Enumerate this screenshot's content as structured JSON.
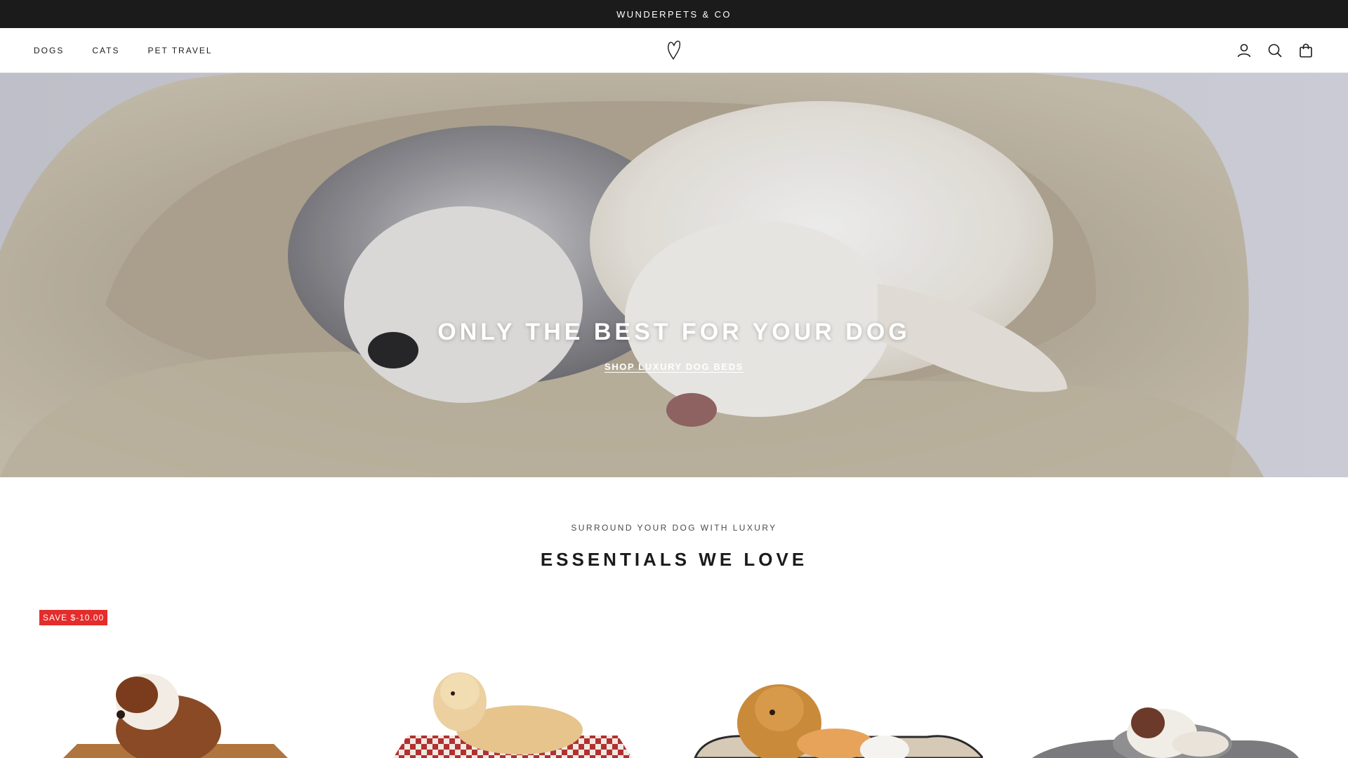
{
  "announcement": {
    "text": "WUNDERPETS & CO"
  },
  "header": {
    "nav": [
      {
        "label": "DOGS"
      },
      {
        "label": "CATS"
      },
      {
        "label": "PET TRAVEL"
      }
    ],
    "icons": [
      "account-icon",
      "search-icon",
      "cart-icon"
    ]
  },
  "hero": {
    "title": "ONLY THE BEST FOR YOUR DOG",
    "cta": "SHOP LUXURY DOG BEDS"
  },
  "section": {
    "subheading": "SURROUND YOUR DOG WITH LUXURY",
    "heading": "ESSENTIALS WE LOVE"
  },
  "products": [
    {
      "badge": "SAVE $-10.00"
    },
    {
      "badge": ""
    },
    {
      "badge": ""
    },
    {
      "badge": ""
    }
  ],
  "colors": {
    "announcement_bg": "#1c1b1b",
    "badge_red": "#e32c2b",
    "text": "#1c1b1b"
  }
}
